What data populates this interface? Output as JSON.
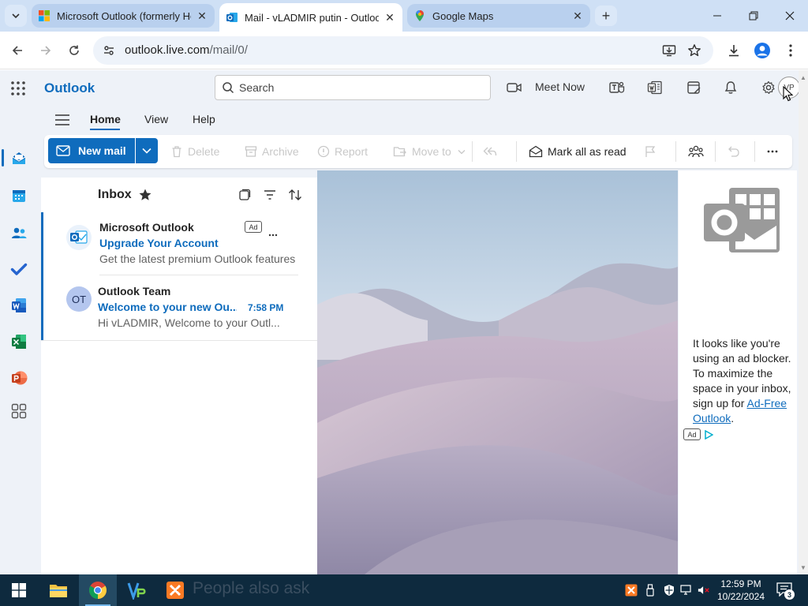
{
  "browser": {
    "tabs": [
      {
        "title": "Microsoft Outlook (formerly Ho",
        "favicon": "microsoft-logo-icon",
        "active": false
      },
      {
        "title": "Mail - vLADMIR putin - Outlook",
        "favicon": "outlook-icon",
        "active": true
      },
      {
        "title": "Google Maps",
        "favicon": "google-maps-icon",
        "active": false
      }
    ],
    "url_host": "outlook.live.com",
    "url_path": "/mail/0/"
  },
  "outlook": {
    "brand": "Outlook",
    "search_placeholder": "Search",
    "meet_now_label": "Meet Now",
    "avatar_initials": "VP",
    "ribbon_tabs": [
      "Home",
      "View",
      "Help"
    ],
    "new_mail_label": "New mail",
    "ribbon_buttons": {
      "delete": "Delete",
      "archive": "Archive",
      "report": "Report",
      "move_to": "Move to",
      "mark_all_read": "Mark all as read"
    },
    "inbox_title": "Inbox",
    "messages": [
      {
        "avatar": "outlook-icon",
        "from": "Microsoft Outlook",
        "badge": "Ad",
        "subject": "Upgrade Your Account",
        "preview": "Get the latest premium Outlook features"
      },
      {
        "avatar_initials": "OT",
        "from": "Outlook Team",
        "subject": "Welcome to your new Ou...",
        "time": "7:58 PM",
        "preview": "Hi vLADMIR, Welcome to your Outl..."
      }
    ],
    "ad_pane": {
      "text_before": "It looks like you're using an ad blocker. To maximize the space in your inbox, sign up for ",
      "link_text": "Ad-Free Outlook",
      "text_after": ".",
      "badge": "Ad"
    }
  },
  "taskbar": {
    "search_overlay_text": "People also ask",
    "time": "12:59 PM",
    "date": "10/22/2024",
    "notification_count": "3"
  },
  "colors": {
    "accent": "#0f6cbd",
    "tabstrip": "#cfe0f5",
    "taskbar": "#0e2a3e"
  }
}
